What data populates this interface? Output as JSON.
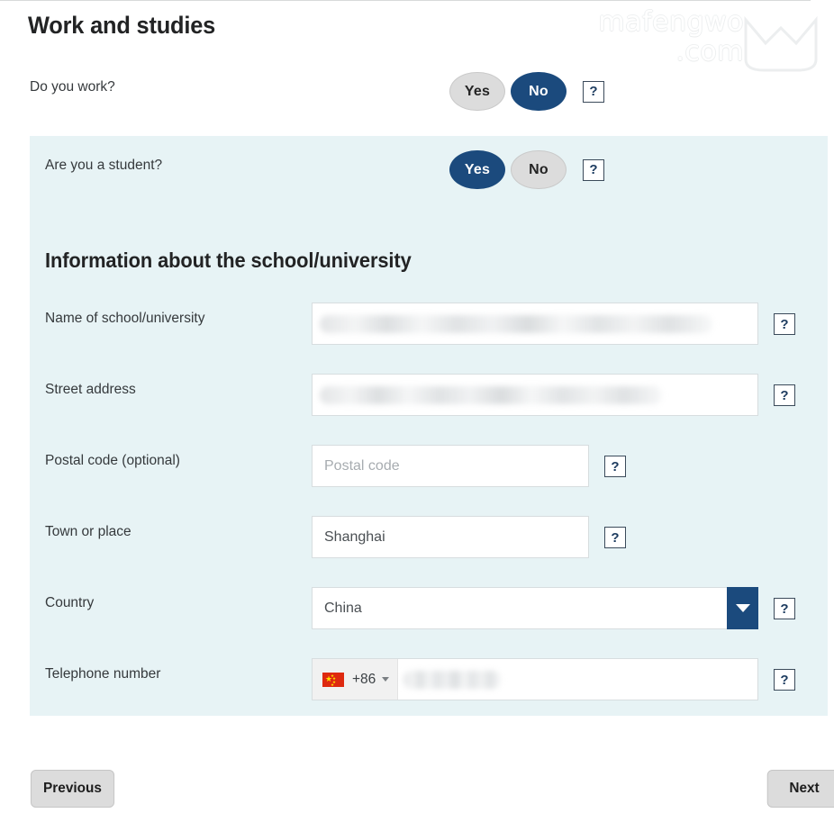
{
  "page": {
    "title": "Work and studies"
  },
  "watermark": {
    "text": "mafengwo\n.com",
    "logo_icon": "mafengwo-logo-icon"
  },
  "questions": [
    {
      "label": "Do you work?",
      "options": [
        "Yes",
        "No"
      ],
      "selected": "No",
      "help_label": "?"
    },
    {
      "label": "Are you a student?",
      "options": [
        "Yes",
        "No"
      ],
      "selected": "Yes",
      "help_label": "?"
    }
  ],
  "school_section": {
    "title": "Information about the school/university",
    "fields": {
      "name": {
        "label": "Name of school/university",
        "value": "",
        "redacted": true,
        "help_label": "?"
      },
      "street": {
        "label": "Street address",
        "value": "",
        "redacted": true,
        "help_label": "?"
      },
      "postal": {
        "label": "Postal code (optional)",
        "value": "",
        "placeholder": "Postal code",
        "help_label": "?"
      },
      "town": {
        "label": "Town or place",
        "value": "Shanghai",
        "help_label": "?"
      },
      "country": {
        "label": "Country",
        "value": "China",
        "dropdown_icon": "chevron-down-icon",
        "help_label": "?"
      },
      "telephone": {
        "label": "Telephone number",
        "flag_icon": "china-flag-icon",
        "dial_code": "+86",
        "caret_icon": "caret-down-icon",
        "value": "",
        "redacted": true,
        "help_label": "?"
      }
    }
  },
  "footer": {
    "previous_label": "Previous",
    "next_label": "Next"
  },
  "colors": {
    "accent_navy": "#1b4a7d",
    "panel_bg": "#e7f3f5",
    "toggle_off": "#dcdcdc",
    "flag_red": "#de2910",
    "flag_yellow": "#ffde00"
  }
}
